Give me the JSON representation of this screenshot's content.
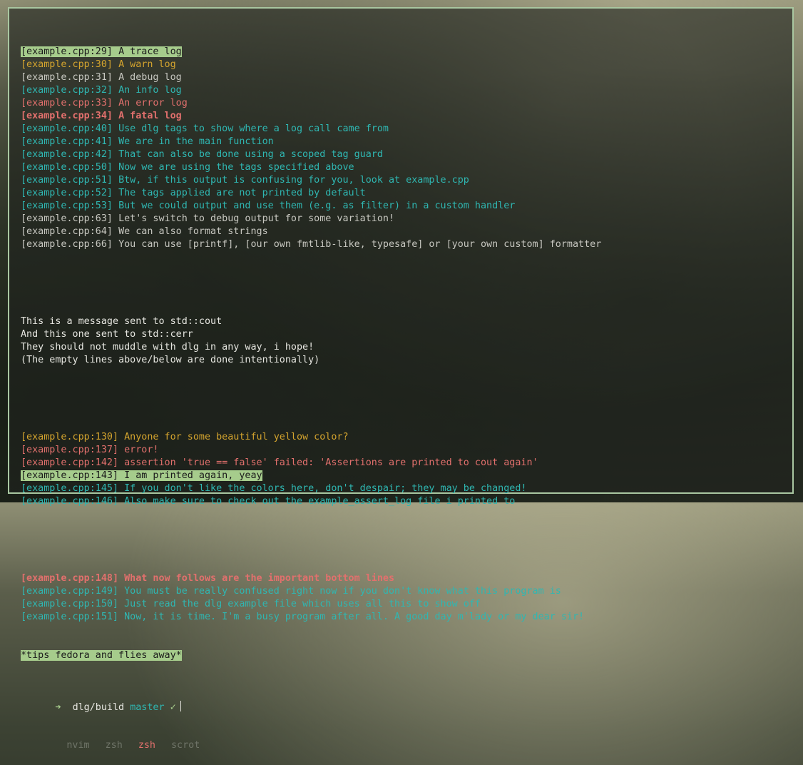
{
  "log_lines": [
    {
      "tag": "[example.cpp:29]",
      "text": "A trace log",
      "style": "trace-hl"
    },
    {
      "tag": "[example.cpp:30]",
      "text": "A warn log",
      "style": "warn"
    },
    {
      "tag": "[example.cpp:31]",
      "text": "A debug log",
      "style": "debug"
    },
    {
      "tag": "[example.cpp:32]",
      "text": "An info log",
      "style": "info"
    },
    {
      "tag": "[example.cpp:33]",
      "text": "An error log",
      "style": "error"
    },
    {
      "tag": "[example.cpp:34]",
      "text": "A fatal log",
      "style": "fatal"
    },
    {
      "tag": "[example.cpp:40]",
      "text": "Use dlg tags to show where a log call came from",
      "style": "info"
    },
    {
      "tag": "[example.cpp:41]",
      "text": "We are in the main function",
      "style": "info"
    },
    {
      "tag": "[example.cpp:42]",
      "text": "That can also be done using a scoped tag guard",
      "style": "info"
    },
    {
      "tag": "[example.cpp:50]",
      "text": "Now we are using the tags specified above",
      "style": "info"
    },
    {
      "tag": "[example.cpp:51]",
      "text": "Btw, if this output is confusing for you, look at example.cpp",
      "style": "info"
    },
    {
      "tag": "[example.cpp:52]",
      "text": "The tags applied are not printed by default",
      "style": "info"
    },
    {
      "tag": "[example.cpp:53]",
      "text": "But we could output and use them (e.g. as filter) in a custom handler",
      "style": "info"
    },
    {
      "tag": "[example.cpp:63]",
      "text": "Let's switch to debug output for some variation!",
      "style": "debug"
    },
    {
      "tag": "[example.cpp:64]",
      "text": "We can also format strings",
      "style": "debug"
    },
    {
      "tag": "[example.cpp:66]",
      "text": "You can use [printf], [our own fmtlib-like, typesafe] or [your own custom] formatter",
      "style": "debug"
    }
  ],
  "plain_lines": [
    "This is a message sent to std::cout",
    "And this one sent to std::cerr",
    "They should not muddle with dlg in any way, i hope!",
    "(The empty lines above/below are done intentionally)"
  ],
  "log_lines_2": [
    {
      "tag": "[example.cpp:130]",
      "text": "Anyone for some beautiful yellow color?",
      "style": "warn"
    },
    {
      "tag": "[example.cpp:137]",
      "text": "error!",
      "style": "error"
    },
    {
      "tag": "[example.cpp:142]",
      "text": "assertion 'true == false' failed: 'Assertions are printed to cout again'",
      "style": "error"
    },
    {
      "tag": "[example.cpp:143]",
      "text": "I am printed again, yeay",
      "style": "trace-hl"
    },
    {
      "tag": "[example.cpp:145]",
      "text": "If you don't like the colors here, don't despair; they may be changed!",
      "style": "info"
    },
    {
      "tag": "[example.cpp:146]",
      "text": "Also make sure to check out the example_assert_log file i printed to",
      "style": "info"
    }
  ],
  "log_lines_3": [
    {
      "tag": "[example.cpp:148]",
      "text": "What now follows are the important bottom lines",
      "style": "fatal"
    },
    {
      "tag": "[example.cpp:149]",
      "text": "You must be really confused right now if you don't know what this program is",
      "style": "info"
    },
    {
      "tag": "[example.cpp:150]",
      "text": "Just read the dlg example file which uses all this to show off",
      "style": "info"
    },
    {
      "tag": "[example.cpp:151]",
      "text": "Now, it is time. I'm a busy program after all. A good day m'lady or my dear sir!",
      "style": "info"
    }
  ],
  "final_line": "*tips fedora and flies away*",
  "prompt": {
    "arrow": "➜",
    "dir": "dlg/build",
    "branch": "master",
    "check": "✓"
  },
  "tabs": [
    {
      "label": "nvim",
      "active": false
    },
    {
      "label": "zsh",
      "active": false
    },
    {
      "label": "zsh",
      "active": true
    },
    {
      "label": "scrot",
      "active": false
    }
  ]
}
